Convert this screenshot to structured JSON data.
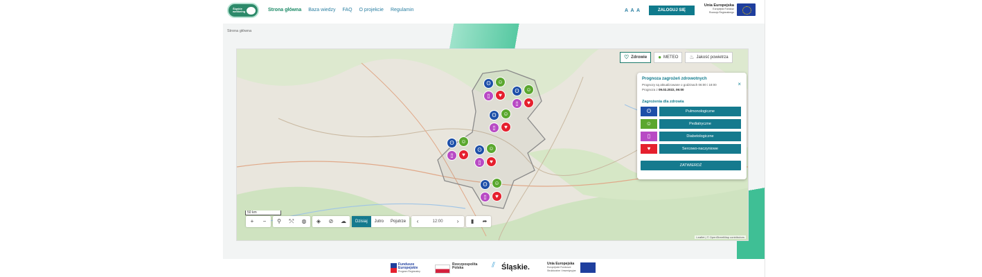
{
  "header": {
    "logo_text": "Śląskie\nwellbeing",
    "nav": [
      "Strona główna",
      "Baza wiedzy",
      "FAQ",
      "O projekcie",
      "Regulamin"
    ],
    "font_size_label": "A A A",
    "login_label": "ZALOGUJ SIĘ",
    "eu_title": "Unia Europejska",
    "eu_sub1": "Europejski Fundusz",
    "eu_sub2": "Rozwoju Regionalnego"
  },
  "breadcrumb": "Strona główna",
  "layers": {
    "zdrowie": "Zdrowie",
    "meteo": "METEO",
    "air": "Jakość powietrza"
  },
  "panel": {
    "title": "Prognoza zagrożeń zdrowotnych",
    "update": "Prognozy są aktualizowane o godzinach 06:00 i 18:00",
    "forecast_prefix": "Prognoza z",
    "forecast_date": "09.02.2022, 06:00",
    "section": "Zagrożenia dla zdrowia",
    "rows": [
      {
        "label": "Pulmonologiczne",
        "color": "#1d4fa8",
        "icon": "lungs-icon"
      },
      {
        "label": "Pediatryczne",
        "color": "#5aa72e",
        "icon": "child-icon"
      },
      {
        "label": "Diabetologiczne",
        "color": "#b84ac4",
        "icon": "glucometer-icon"
      },
      {
        "label": "Sercowo-naczyniowe",
        "color": "#e5202e",
        "icon": "heart-icon"
      }
    ],
    "confirm": "ZATWIERDŹ"
  },
  "toolbar": {
    "scale": "50 km",
    "days": [
      "Dzisiaj",
      "Jutro",
      "Pojutrze"
    ],
    "time": "12:00"
  },
  "map": {
    "attribution": "Leaflet | © OpenStreetMap contributors"
  },
  "footer": {
    "fe_title1": "Fundusze",
    "fe_title2": "Europejskie",
    "fe_sub": "Program Regionalny",
    "pl_title1": "Rzeczpospolita",
    "pl_title2": "Polska",
    "slaskie": "Śląskie.",
    "ue_title": "Unia Europejska",
    "ue_sub1": "Europejskie Fundusze",
    "ue_sub2": "Strukturalne i Inwestycyjne"
  }
}
